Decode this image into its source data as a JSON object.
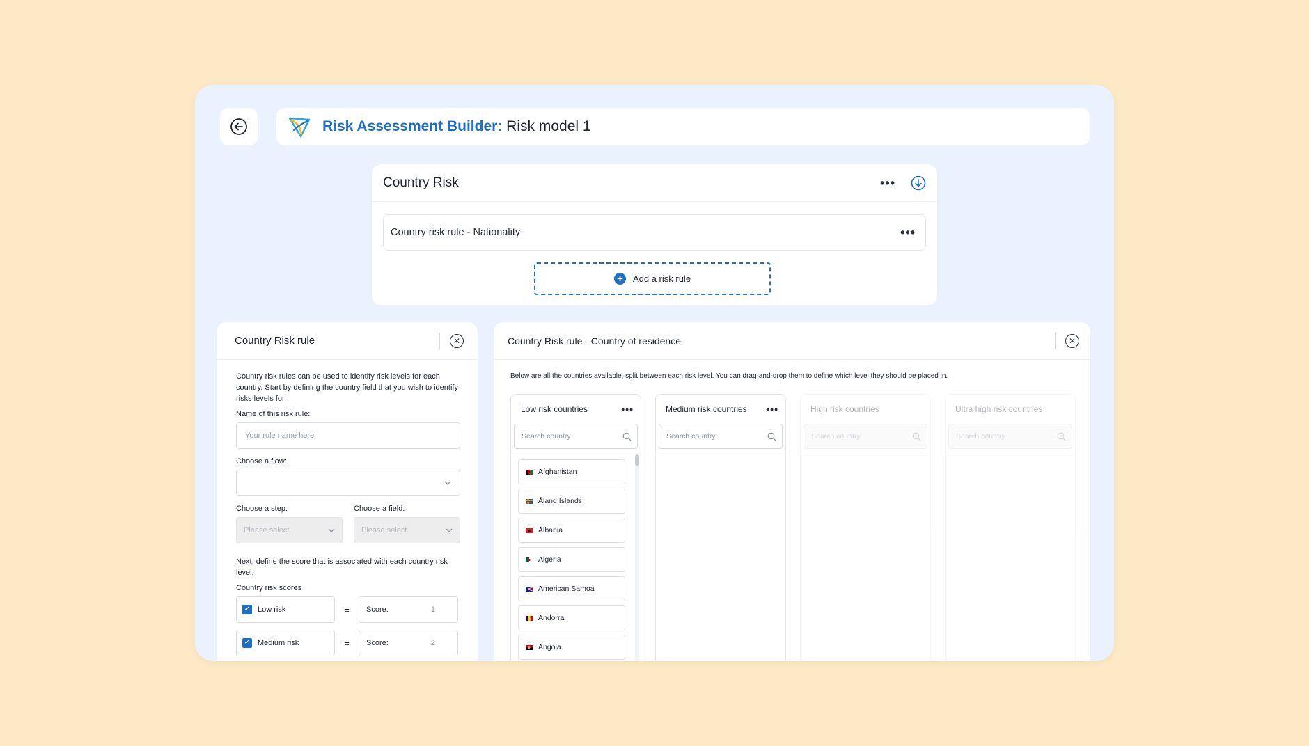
{
  "header": {
    "title_accent": "Risk Assessment Builder:",
    "title_rest": "Risk model 1"
  },
  "country_risk": {
    "title": "Country Risk",
    "rule_label": "Country  risk rule - Nationality",
    "add_rule_label": "Add a risk rule"
  },
  "left_panel": {
    "title": "Country Risk rule",
    "description": "Country risk rules can be used to identify risk levels for each country. Start by defining the country field that you wish to identify risks levels for.",
    "name_label": "Name of this risk rule:",
    "name_placeholder": "Your rule name here",
    "flow_label": "Choose a flow:",
    "step_label": "Choose a step:",
    "step_placeholder": "Please select",
    "field_label": "Choose a field:",
    "field_placeholder": "Please select",
    "score_desc": "Next, define the score that is associated with each country risk level:",
    "scores_label": "Country risk scores",
    "scores": [
      {
        "risk": "Low risk",
        "score_label": "Score:",
        "value": "1"
      },
      {
        "risk": "Medium risk",
        "score_label": "Score:",
        "value": "2"
      }
    ]
  },
  "right_panel": {
    "title": "Country Risk rule - Country of residence",
    "description": "Below are all the countries available, split between each risk level. You can drag-and-drop them to define which level they should be placed in.",
    "columns": [
      {
        "title": "Low risk countries",
        "search_placeholder": "Search country"
      },
      {
        "title": "Medium risk countries",
        "search_placeholder": "Search country"
      },
      {
        "title": "High risk countries",
        "search_placeholder": "Search country"
      },
      {
        "title": "Ultra high risk countries",
        "search_placeholder": "Search country"
      }
    ],
    "low_countries": [
      "Afghanistan",
      "Åland Islands",
      "Albania",
      "Algeria",
      "American Samoa",
      "Andorra",
      "Angola"
    ]
  },
  "colors": {
    "accent": "#1f6fc6",
    "background": "#fde9c5",
    "frame": "#eaf1ff"
  }
}
